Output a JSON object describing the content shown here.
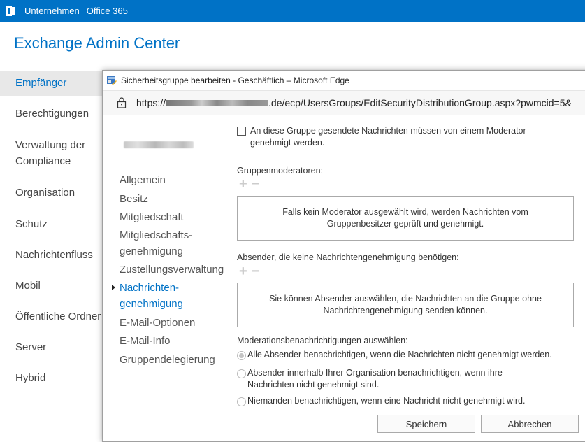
{
  "topbar": {
    "company": "Unternehmen",
    "office": "Office 365"
  },
  "app": {
    "title": "Exchange Admin Center"
  },
  "nav": {
    "items": [
      "Empfänger",
      "Berechtigungen",
      "Verwaltung der",
      "Compliance",
      "Organisation",
      "Schutz",
      "Nachrichtenfluss",
      "Mobil",
      "Öffentliche Ordner",
      "Server",
      "Hybrid"
    ]
  },
  "window": {
    "title": "Sicherheitsgruppe bearbeiten - Geschäftlich – Microsoft Edge",
    "url_prefix": "https://",
    "url_suffix": ".de/ecp/UsersGroups/EditSecurityDistributionGroup.aspx?pwmcid=5&"
  },
  "side_nav": {
    "items": [
      "Allgemein",
      "Besitz",
      "Mitgliedschaft",
      "Mitgliedschafts-",
      "genehmigung",
      "Zustellungsverwaltung",
      "Nachrichten-",
      "genehmigung",
      "E-Mail-Optionen",
      "E-Mail-Info",
      "Gruppendelegierung"
    ]
  },
  "main": {
    "moderation_checkbox": "An diese Gruppe gesendete Nachrichten müssen von einem Moderator genehmigt werden.",
    "moderators_label": "Gruppenmoderatoren:",
    "moderators_box": "Falls kein Moderator ausgewählt wird, werden Nachrichten vom Gruppenbesitzer geprüft und genehmigt.",
    "bypass_label": "Absender, die keine Nachrichtengenehmigung benötigen:",
    "bypass_box": "Sie können Absender auswählen, die Nachrichten an die Gruppe ohne Nachrichtengenehmigung senden können.",
    "notify_label": "Moderationsbenachrichtigungen auswählen:",
    "radio_all": "Alle Absender benachrichtigen, wenn die Nachrichten nicht genehmigt werden.",
    "radio_internal": "Absender innerhalb Ihrer Organisation benachrichtigen, wenn ihre Nachrichten nicht genehmigt sind.",
    "radio_none": "Niemanden benachrichtigen, wenn eine Nachricht nicht genehmigt wird.",
    "plus": "+",
    "minus": "−"
  },
  "buttons": {
    "save": "Speichern",
    "cancel": "Abbrechen"
  }
}
